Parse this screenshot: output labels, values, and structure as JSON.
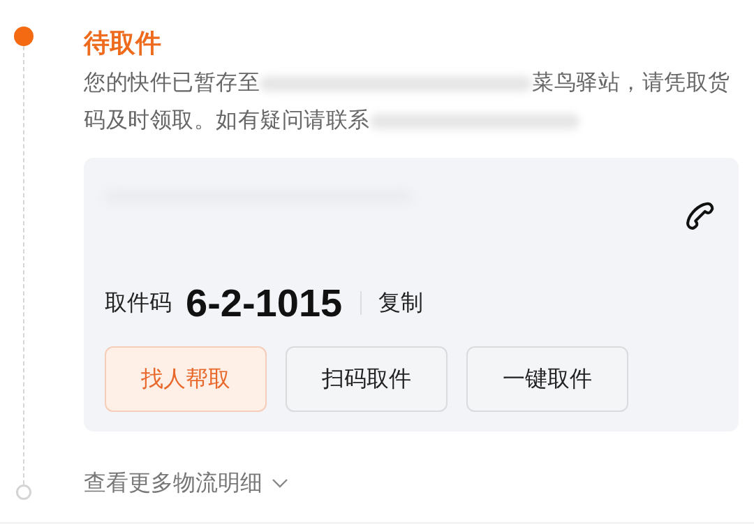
{
  "status": {
    "title": "待取件",
    "active": true
  },
  "message": [
    {
      "kind": "text",
      "text": "您的快件已暂存至"
    },
    {
      "kind": "redacted"
    },
    {
      "kind": "text",
      "text": "菜鸟驿站，请凭取货码及时领取。如有疑问请联系"
    },
    {
      "kind": "redacted"
    }
  ],
  "pickup": {
    "label": "取件码",
    "code": "6-2-1015",
    "copy": "复制"
  },
  "actions": [
    {
      "label": "找人帮取",
      "highlighted": true
    },
    {
      "label": "扫码取件",
      "highlighted": false
    },
    {
      "label": "一键取件",
      "highlighted": false
    }
  ],
  "more": {
    "label": "查看更多物流明细",
    "expanded": false
  }
}
